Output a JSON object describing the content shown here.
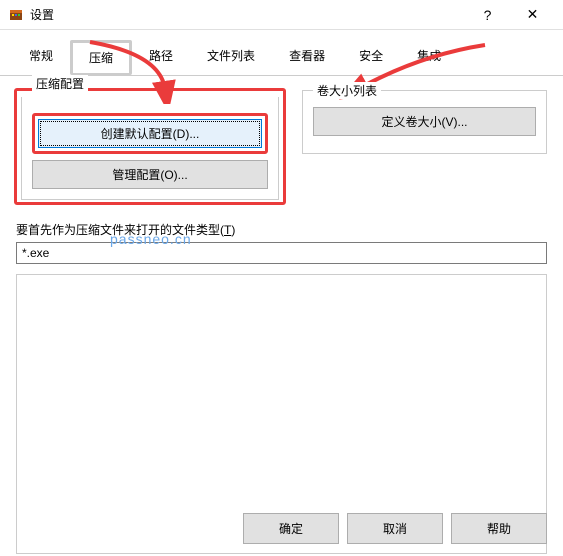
{
  "window": {
    "title": "设置",
    "help_icon": "?",
    "close_icon": "✕"
  },
  "tabs": [
    {
      "label": "常规"
    },
    {
      "label": "压缩"
    },
    {
      "label": "路径"
    },
    {
      "label": "文件列表"
    },
    {
      "label": "查看器"
    },
    {
      "label": "安全"
    },
    {
      "label": "集成"
    }
  ],
  "groups": {
    "compress": {
      "title": "压缩配置",
      "create_default": "创建默认配置(D)...",
      "manage": "管理配置(O)..."
    },
    "volume": {
      "title": "卷大小列表",
      "define": "定义卷大小(V)..."
    }
  },
  "filetype": {
    "label_pre": "要首先作为压缩文件来打开的文件类型(",
    "label_key": "T",
    "label_post": ")",
    "value": "*.exe"
  },
  "watermark": "passneo.cn",
  "footer": {
    "ok": "确定",
    "cancel": "取消",
    "help": "帮助"
  }
}
